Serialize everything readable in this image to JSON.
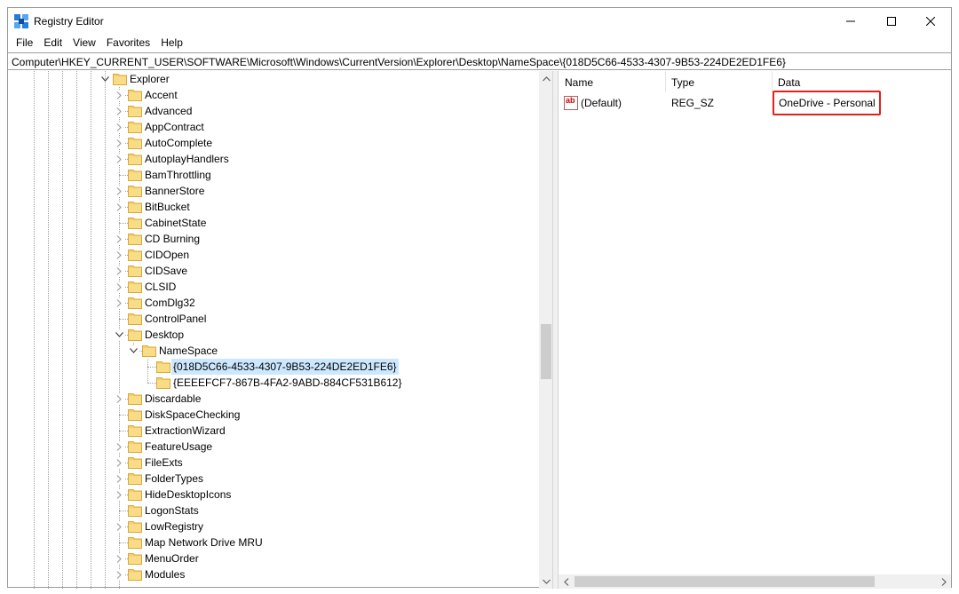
{
  "window": {
    "title": "Registry Editor",
    "minimize_icon": "minimize-icon",
    "maximize_icon": "maximize-icon",
    "close_icon": "close-icon"
  },
  "menu": [
    "File",
    "Edit",
    "View",
    "Favorites",
    "Help"
  ],
  "address": "Computer\\HKEY_CURRENT_USER\\SOFTWARE\\Microsoft\\Windows\\CurrentVersion\\Explorer\\Desktop\\NameSpace\\{018D5C66-4533-4307-9B53-224DE2ED1FE6}",
  "tree": {
    "root": "Explorer",
    "nodes": [
      {
        "label": "Accent",
        "level": 1,
        "expander": "collapsed"
      },
      {
        "label": "Advanced",
        "level": 1,
        "expander": "collapsed"
      },
      {
        "label": "AppContract",
        "level": 1,
        "expander": "collapsed"
      },
      {
        "label": "AutoComplete",
        "level": 1,
        "expander": "collapsed"
      },
      {
        "label": "AutoplayHandlers",
        "level": 1,
        "expander": "collapsed"
      },
      {
        "label": "BamThrottling",
        "level": 1,
        "expander": "none"
      },
      {
        "label": "BannerStore",
        "level": 1,
        "expander": "collapsed"
      },
      {
        "label": "BitBucket",
        "level": 1,
        "expander": "collapsed"
      },
      {
        "label": "CabinetState",
        "level": 1,
        "expander": "none"
      },
      {
        "label": "CD Burning",
        "level": 1,
        "expander": "collapsed"
      },
      {
        "label": "CIDOpen",
        "level": 1,
        "expander": "collapsed"
      },
      {
        "label": "CIDSave",
        "level": 1,
        "expander": "collapsed"
      },
      {
        "label": "CLSID",
        "level": 1,
        "expander": "collapsed"
      },
      {
        "label": "ComDlg32",
        "level": 1,
        "expander": "collapsed"
      },
      {
        "label": "ControlPanel",
        "level": 1,
        "expander": "none"
      },
      {
        "label": "Desktop",
        "level": 1,
        "expander": "expanded"
      },
      {
        "label": "NameSpace",
        "level": 2,
        "expander": "expanded"
      },
      {
        "label": "{018D5C66-4533-4307-9B53-224DE2ED1FE6}",
        "level": 3,
        "expander": "none",
        "selected": true
      },
      {
        "label": "{EEEEFCF7-867B-4FA2-9ABD-884CF531B612}",
        "level": 3,
        "expander": "none"
      },
      {
        "label": "Discardable",
        "level": 1,
        "expander": "collapsed"
      },
      {
        "label": "DiskSpaceChecking",
        "level": 1,
        "expander": "none"
      },
      {
        "label": "ExtractionWizard",
        "level": 1,
        "expander": "none"
      },
      {
        "label": "FeatureUsage",
        "level": 1,
        "expander": "collapsed"
      },
      {
        "label": "FileExts",
        "level": 1,
        "expander": "collapsed"
      },
      {
        "label": "FolderTypes",
        "level": 1,
        "expander": "collapsed"
      },
      {
        "label": "HideDesktopIcons",
        "level": 1,
        "expander": "collapsed"
      },
      {
        "label": "LogonStats",
        "level": 1,
        "expander": "none"
      },
      {
        "label": "LowRegistry",
        "level": 1,
        "expander": "collapsed"
      },
      {
        "label": "Map Network Drive MRU",
        "level": 1,
        "expander": "none"
      },
      {
        "label": "MenuOrder",
        "level": 1,
        "expander": "collapsed"
      },
      {
        "label": "Modules",
        "level": 1,
        "expander": "collapsed"
      }
    ]
  },
  "list": {
    "columns": [
      "Name",
      "Type",
      "Data"
    ],
    "rows": [
      {
        "icon": "string-value-icon",
        "name": "(Default)",
        "type": "REG_SZ",
        "data": "OneDrive - Personal"
      }
    ]
  },
  "colors": {
    "selection": "#cce8ff",
    "folder": "#f3c24f",
    "highlight_box": "#e0201c"
  }
}
